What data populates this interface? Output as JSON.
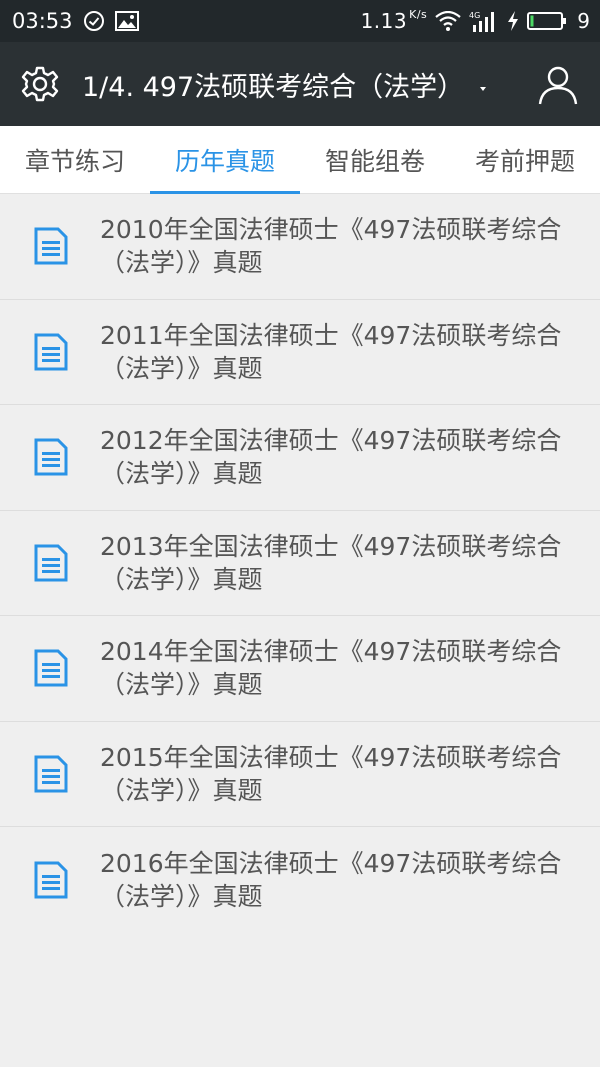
{
  "statusbar": {
    "time": "03:53",
    "network_speed": "1.13",
    "network_unit": "K/s",
    "signal_type": "4G",
    "battery_level": "9"
  },
  "appbar": {
    "title": "1/4. 497法硕联考综合（法学）"
  },
  "tabs": [
    {
      "label": "章节练习",
      "active": false
    },
    {
      "label": "历年真题",
      "active": true
    },
    {
      "label": "智能组卷",
      "active": false
    },
    {
      "label": "考前押题",
      "active": false
    }
  ],
  "items": [
    {
      "title": "2010年全国法律硕士《497法硕联考综合（法学）》真题"
    },
    {
      "title": "2011年全国法律硕士《497法硕联考综合（法学）》真题"
    },
    {
      "title": "2012年全国法律硕士《497法硕联考综合（法学）》真题"
    },
    {
      "title": "2013年全国法律硕士《497法硕联考综合（法学）》真题"
    },
    {
      "title": "2014年全国法律硕士《497法硕联考综合（法学）》真题"
    },
    {
      "title": "2015年全国法律硕士《497法硕联考综合（法学）》真题"
    },
    {
      "title": "2016年全国法律硕士《497法硕联考综合（法学）》真题"
    }
  ],
  "colors": {
    "accent": "#2a93e6",
    "appbar": "#2b3134",
    "statusbar": "#22282b",
    "background": "#efefef"
  },
  "icons": {
    "settings": "gear-icon",
    "account": "user-icon",
    "list_item": "document-icon",
    "title_menu": "caret-down-icon"
  }
}
